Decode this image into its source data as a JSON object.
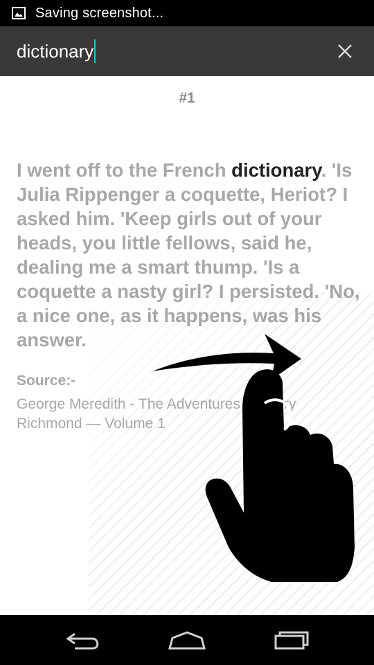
{
  "status_bar": {
    "icon": "image-icon",
    "text": "Saving screenshot..."
  },
  "search": {
    "query": "dictionary",
    "close_icon": "close-icon"
  },
  "result": {
    "number": "#1",
    "quote_before": "I went off to the French ",
    "quote_highlight": "dictionary",
    "quote_after": ". 'Is Julia Rippenger a coquette, Heriot? I asked him. 'Keep girls out of your heads, you little fellows, said he, dealing me a smart thump. 'Is a coquette a nasty girl? I persisted. 'No, a nice one, as it happens, was his answer.",
    "source_label": "Source:-",
    "source_text": "George Meredith - The Adventures of Harry Richmond — Volume 1"
  },
  "overlay": {
    "icon": "swipe-gesture-hand-icon"
  },
  "nav_bar": {
    "back_icon": "back-icon",
    "home_icon": "home-icon",
    "recents_icon": "recent-apps-icon"
  }
}
